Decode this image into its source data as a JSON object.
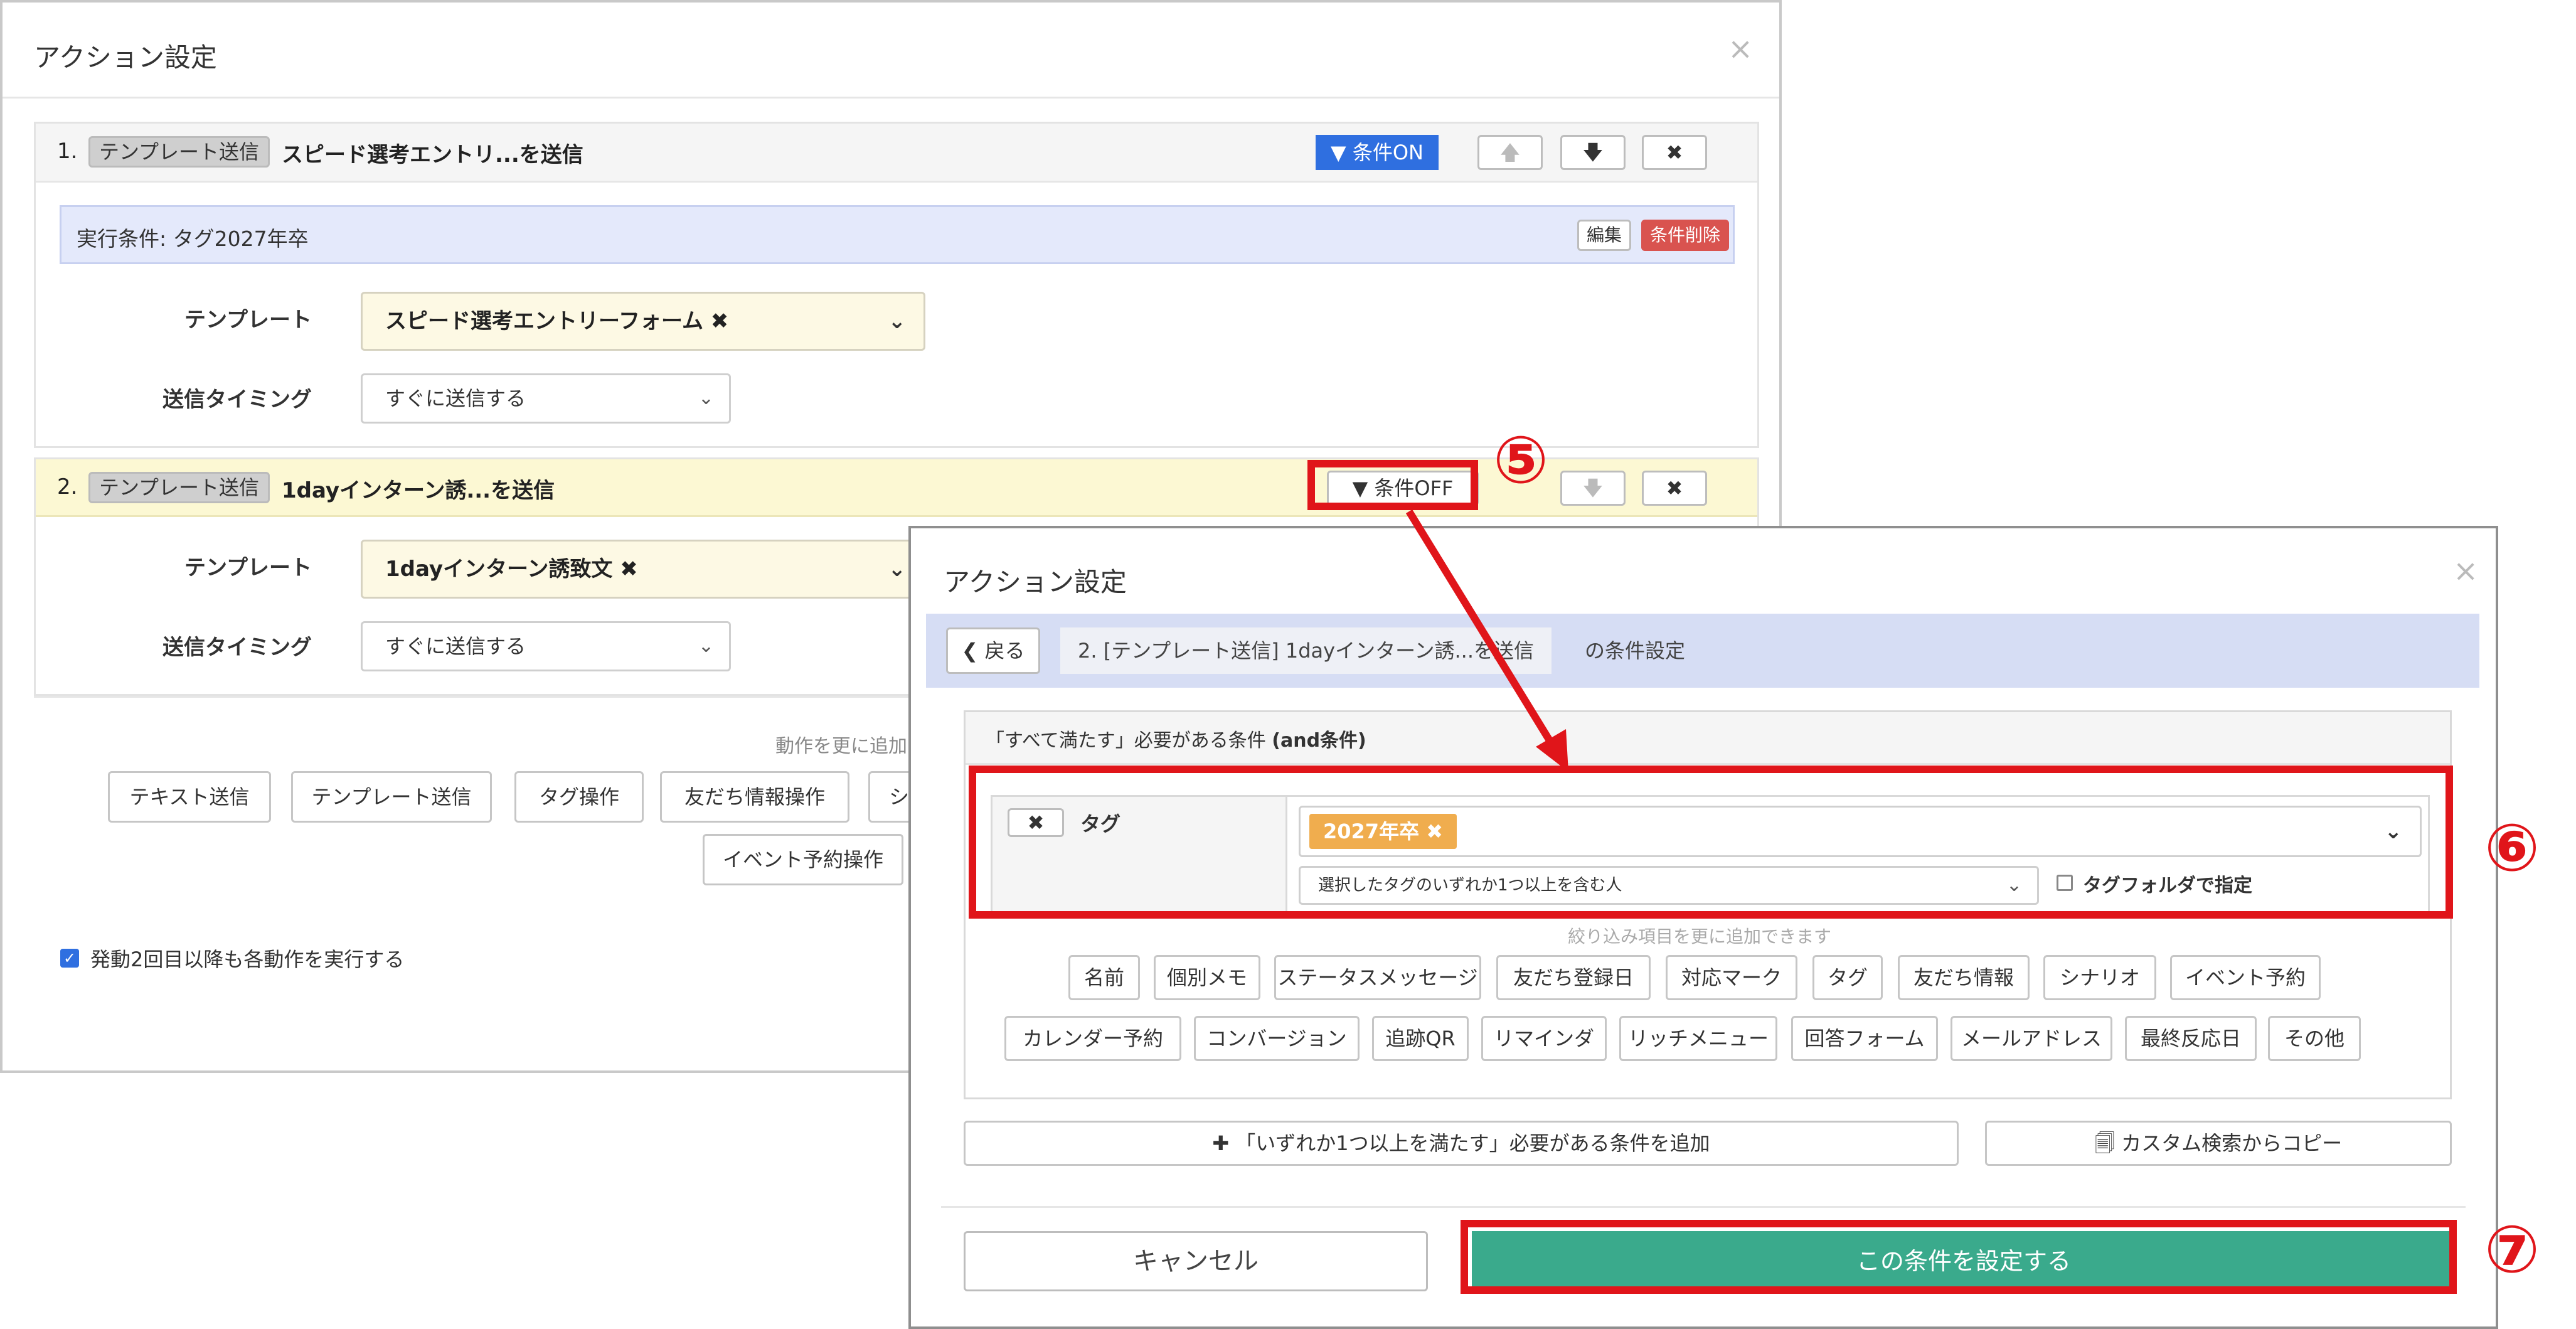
{
  "modal1": {
    "title": "アクション設定",
    "close": "×",
    "action1": {
      "number": "1.",
      "type_badge": "テンプレート送信",
      "name": "スピード選考エントリ...を送信",
      "cond_button": "条件ON",
      "condition_text": "実行条件: タグ2027年卒",
      "edit_label": "編集",
      "delete_label": "条件削除",
      "template_label": "テンプレート",
      "template_value": "スピード選考エントリーフォーム ✖",
      "timing_label": "送信タイミング",
      "timing_value": "すぐに送信する"
    },
    "action2": {
      "number": "2.",
      "type_badge": "テンプレート送信",
      "name": "1dayインターン誘...を送信",
      "cond_button": "条件OFF",
      "template_label": "テンプレート",
      "template_value": "1dayインターン誘致文 ✖",
      "timing_label": "送信タイミング",
      "timing_value": "すぐに送信する"
    },
    "add_more_label": "動作を更に追加",
    "add_buttons": [
      "テキスト送信",
      "テンプレート送信",
      "タグ操作",
      "友だち情報操作",
      "シナ"
    ],
    "event_button": "イベント予約操作",
    "repeat_checkbox_label": "発動2回目以降も各動作を実行する",
    "repeat_checked": true
  },
  "modal2": {
    "title": "アクション設定",
    "close": "×",
    "back_label": "戻る",
    "crumb": "2. [テンプレート送信] 1dayインターン誘...を送信",
    "crumb_suffix": "の条件設定",
    "and_header_prefix": "「すべて満たす」必要がある条件",
    "and_header_bold": "(and条件)",
    "tag_label": "タグ",
    "tag_chip": "2027年卒 ✖",
    "match_mode": "選択したタグのいずれか1つ以上を含む人",
    "folder_label": "タグフォルダで指定",
    "folder_checked": false,
    "add_hint": "絞り込み項目を更に追加できます",
    "filter_row1": [
      "名前",
      "個別メモ",
      "ステータスメッセージ",
      "友だち登録日",
      "対応マーク",
      "タグ",
      "友だち情報",
      "シナリオ",
      "イベント予約"
    ],
    "filter_row2": [
      "カレンダー予約",
      "コンバージョン",
      "追跡QR",
      "リマインダ",
      "リッチメニュー",
      "回答フォーム",
      "メールアドレス",
      "最終反応日",
      "その他"
    ],
    "or_add_label": "「いずれか1つ以上を満たす」必要がある条件を追加",
    "copy_label": "カスタム検索からコピー",
    "cancel_label": "キャンセル",
    "submit_label": "この条件を設定する"
  },
  "annotations": {
    "step5": "⑤",
    "step6": "⑥",
    "step7": "⑦"
  },
  "colors": {
    "cond_on_blue": "#2f6fe0",
    "delete_red": "#d9534f",
    "submit_green": "#3aaa8c",
    "annotation_red": "#e0151a",
    "tag_orange": "#f0ad4e"
  }
}
